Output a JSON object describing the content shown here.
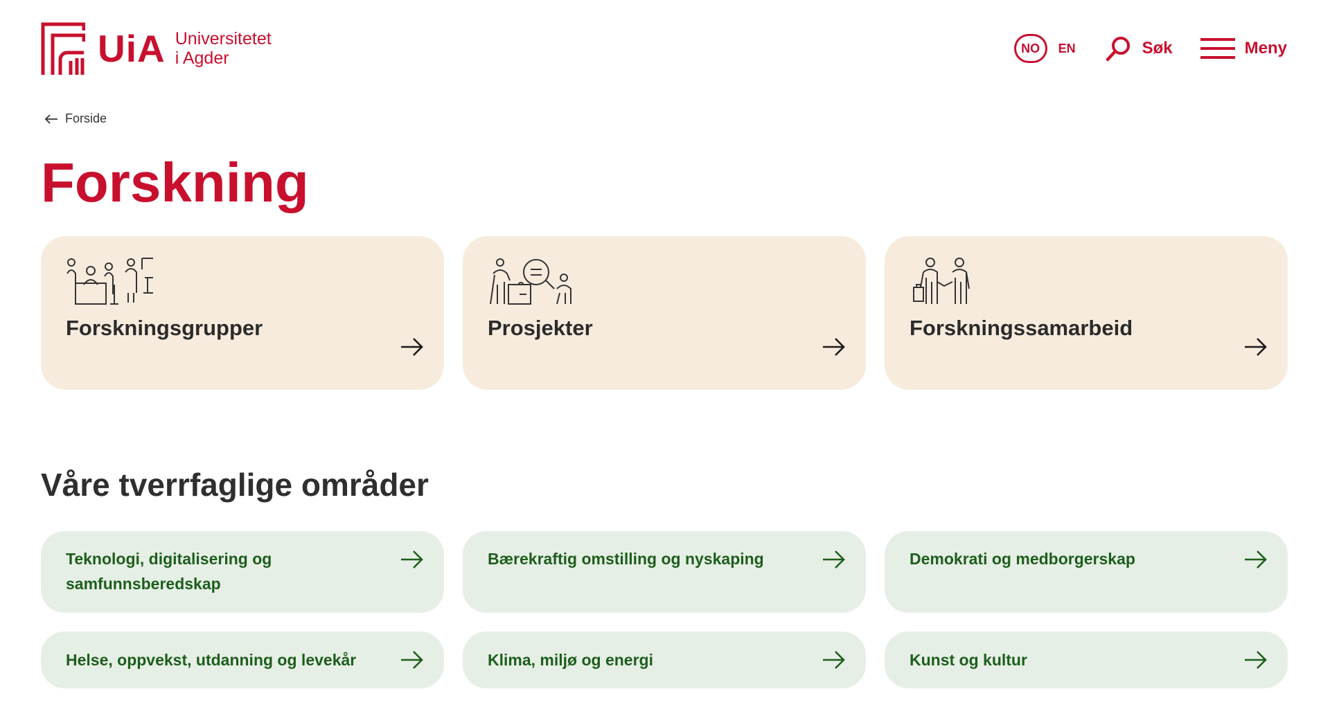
{
  "brand": {
    "short": "UiA",
    "line1": "Universitetet",
    "line2": "i Agder",
    "color": "#c8102e"
  },
  "header": {
    "lang_no": "NO",
    "lang_en": "EN",
    "search_label": "Søk",
    "menu_label": "Meny"
  },
  "breadcrumb": {
    "label": "Forside"
  },
  "page": {
    "title": "Forskning"
  },
  "cards": [
    {
      "label": "Forskningsgrupper",
      "icon": "research-group-illustration"
    },
    {
      "label": "Prosjekter",
      "icon": "projects-illustration"
    },
    {
      "label": "Forskningssamarbeid",
      "icon": "handshake-illustration"
    }
  ],
  "areas_section": {
    "title": "Våre tverrfaglige områder",
    "items": [
      {
        "label": "Teknologi, digitalisering og samfunnsberedskap"
      },
      {
        "label": "Bærekraftig omstilling og nyskaping"
      },
      {
        "label": "Demokrati og medborgerskap"
      },
      {
        "label": "Helse, oppvekst, utdanning og levekår"
      },
      {
        "label": "Klima, miljø og energi"
      },
      {
        "label": "Kunst og kultur"
      }
    ]
  },
  "colors": {
    "card_bg": "#f7ebdd",
    "area_bg": "#e6efe5",
    "area_text": "#1d5e1d"
  }
}
